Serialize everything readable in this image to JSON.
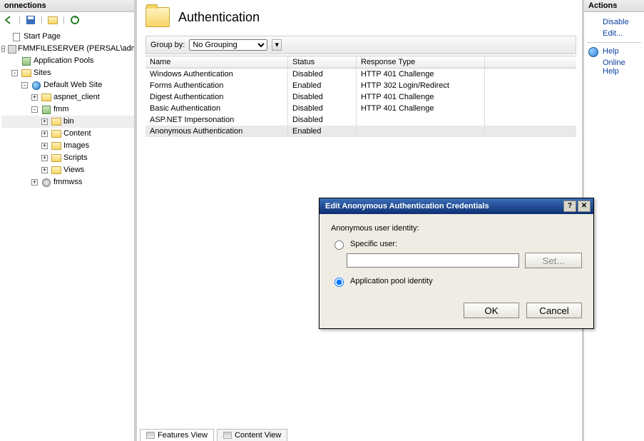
{
  "left": {
    "panel_title": "onnections",
    "toolbar": [
      "back-icon",
      "save-icon",
      "folder-new-icon",
      "refresh-icon"
    ],
    "tree": [
      {
        "lvl": 1,
        "exp": "",
        "icon": "page",
        "label": "Start Page"
      },
      {
        "lvl": 1,
        "exp": "-",
        "icon": "server",
        "label": "FMMFILESERVER (PERSAL\\admin"
      },
      {
        "lvl": 2,
        "exp": "",
        "icon": "app",
        "label": "Application Pools"
      },
      {
        "lvl": 2,
        "exp": "-",
        "icon": "folder",
        "label": "Sites"
      },
      {
        "lvl": 3,
        "exp": "-",
        "icon": "globe",
        "label": "Default Web Site"
      },
      {
        "lvl": 4,
        "exp": "+",
        "icon": "folder",
        "label": "aspnet_client"
      },
      {
        "lvl": 4,
        "exp": "-",
        "icon": "app",
        "label": "fmm"
      },
      {
        "lvl": 5,
        "exp": "+",
        "icon": "folder",
        "label": "bin",
        "selected": true
      },
      {
        "lvl": 5,
        "exp": "+",
        "icon": "folder",
        "label": "Content"
      },
      {
        "lvl": 5,
        "exp": "+",
        "icon": "folder",
        "label": "Images"
      },
      {
        "lvl": 5,
        "exp": "+",
        "icon": "folder",
        "label": "Scripts"
      },
      {
        "lvl": 5,
        "exp": "+",
        "icon": "folder",
        "label": "Views"
      },
      {
        "lvl": 4,
        "exp": "+",
        "icon": "gear",
        "label": "fmmwss"
      }
    ]
  },
  "center": {
    "title": "Authentication",
    "group_label": "Group by:",
    "group_value": "No Grouping",
    "columns": [
      "Name",
      "Status",
      "Response Type"
    ],
    "rows": [
      {
        "name": "Windows Authentication",
        "status": "Disabled",
        "resp": "HTTP 401 Challenge"
      },
      {
        "name": "Forms Authentication",
        "status": "Enabled",
        "resp": "HTTP 302 Login/Redirect"
      },
      {
        "name": "Digest Authentication",
        "status": "Disabled",
        "resp": "HTTP 401 Challenge"
      },
      {
        "name": "Basic Authentication",
        "status": "Disabled",
        "resp": "HTTP 401 Challenge"
      },
      {
        "name": "ASP.NET Impersonation",
        "status": "Disabled",
        "resp": ""
      },
      {
        "name": "Anonymous Authentication",
        "status": "Enabled",
        "resp": "",
        "selected": true
      }
    ],
    "tabs": {
      "features": "Features View",
      "content": "Content View"
    }
  },
  "right": {
    "title": "Actions",
    "items": [
      {
        "label": "Disable",
        "icon": ""
      },
      {
        "label": "Edit...",
        "icon": ""
      },
      {
        "label": "Help",
        "icon": "help"
      },
      {
        "label": "Online Help",
        "icon": ""
      }
    ]
  },
  "dialog": {
    "title": "Edit Anonymous Authentication Credentials",
    "group_label": "Anonymous user identity:",
    "opt_specific": "Specific user:",
    "opt_pool": "Application pool identity",
    "specific_value": "",
    "set_btn": "Set...",
    "ok": "OK",
    "cancel": "Cancel"
  }
}
